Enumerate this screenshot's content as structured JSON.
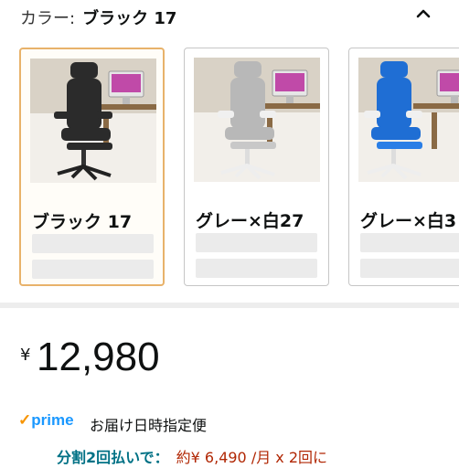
{
  "header": {
    "color_label": "カラー:",
    "selected_color": "ブラック 17",
    "collapse_icon": "chevron-up-icon"
  },
  "swatches": [
    {
      "label": "ブラック 17",
      "selected": true,
      "chair_color": "#2b2b2b"
    },
    {
      "label": "グレー×白27",
      "selected": false,
      "chair_color": "#b8b8b8"
    },
    {
      "label": "グレー×白3",
      "selected": false,
      "chair_color": "#1f6ed4"
    }
  ],
  "price": {
    "currency": "¥",
    "amount": "12,980"
  },
  "prime": {
    "logo": "prime",
    "text": "お届け日時指定便"
  },
  "installment": {
    "lead": "分割2回払いで：",
    "detail": "約¥ 6,490 /月 x 2回に"
  },
  "colors": {
    "selected_border": "#e8b26a",
    "prime_blue": "#1a98ff",
    "link_teal": "#007185",
    "price_red": "#b12704"
  }
}
